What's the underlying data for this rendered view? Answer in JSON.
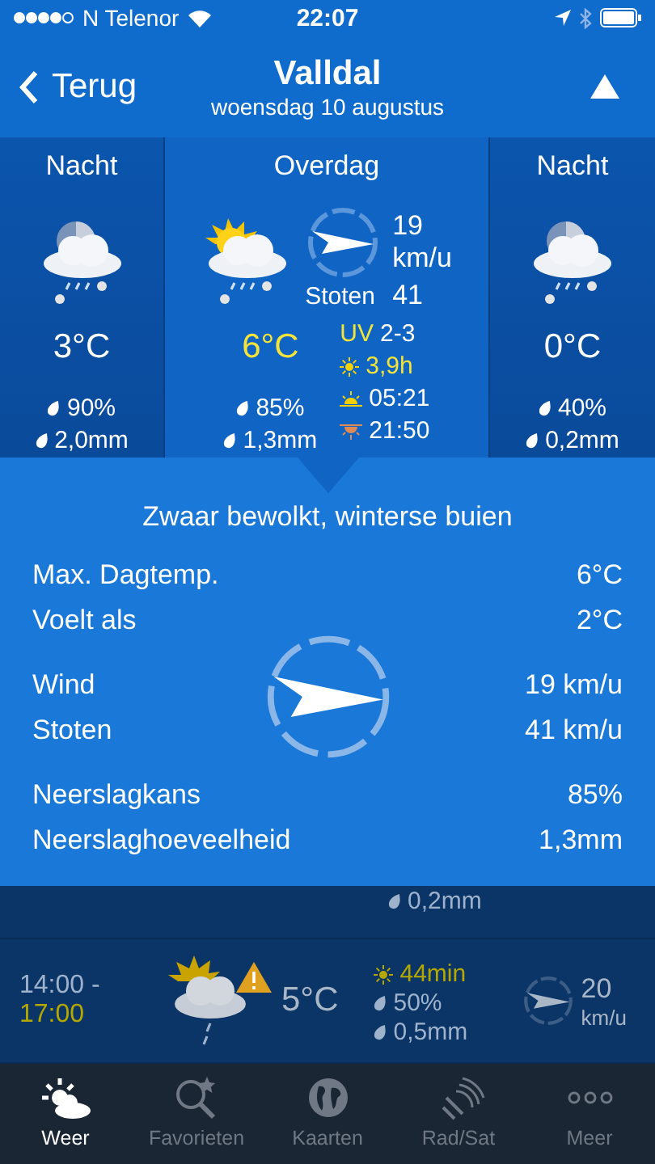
{
  "status_bar": {
    "carrier": "N Telenor",
    "time": "22:07"
  },
  "nav": {
    "back": "Terug",
    "title": "Valldal",
    "subtitle": "woensdag 10 augustus"
  },
  "periods": [
    {
      "label": "Nacht",
      "selected": false,
      "temp": "3°C",
      "chance": "90%",
      "amount": "2,0mm"
    },
    {
      "label": "Overdag",
      "selected": true,
      "temp": "6°C",
      "chance": "85%",
      "amount": "1,3mm",
      "wind": "19",
      "wind_unit": "km/u",
      "gust_label": "Stoten",
      "gust": "41",
      "uv_label": "UV",
      "uv": "2-3",
      "sun_hours": "3,9h",
      "sunrise": "05:21",
      "sunset": "21:50"
    },
    {
      "label": "Nacht",
      "selected": false,
      "temp": "0°C",
      "chance": "40%",
      "amount": "0,2mm"
    }
  ],
  "detail": {
    "summary": "Zwaar bewolkt, winterse buien",
    "groups": [
      {
        "rows": [
          {
            "label": "Max. Dagtemp.",
            "value": "6°C"
          },
          {
            "label": "Voelt als",
            "value": "2°C"
          }
        ]
      },
      {
        "rows": [
          {
            "label": "Wind",
            "value": "19 km/u"
          },
          {
            "label": "Stoten",
            "value": "41 km/u"
          }
        ]
      },
      {
        "rows": [
          {
            "label": "Neerslagkans",
            "value": "85%"
          },
          {
            "label": "Neerslaghoeveelheid",
            "value": "1,3mm"
          }
        ]
      }
    ]
  },
  "hourly": {
    "partial_amount": "0,2mm",
    "row": {
      "from": "14:00 -",
      "to": "17:00",
      "warning": true,
      "temp": "5°C",
      "sun": "44min",
      "chance": "50%",
      "amount": "0,5mm",
      "wind": "20",
      "wind_unit": "km/u"
    }
  },
  "tabs": [
    {
      "label": "Weer",
      "selected": true
    },
    {
      "label": "Favorieten",
      "selected": false
    },
    {
      "label": "Kaarten",
      "selected": false
    },
    {
      "label": "Rad/Sat",
      "selected": false
    },
    {
      "label": "Meer",
      "selected": false
    }
  ]
}
